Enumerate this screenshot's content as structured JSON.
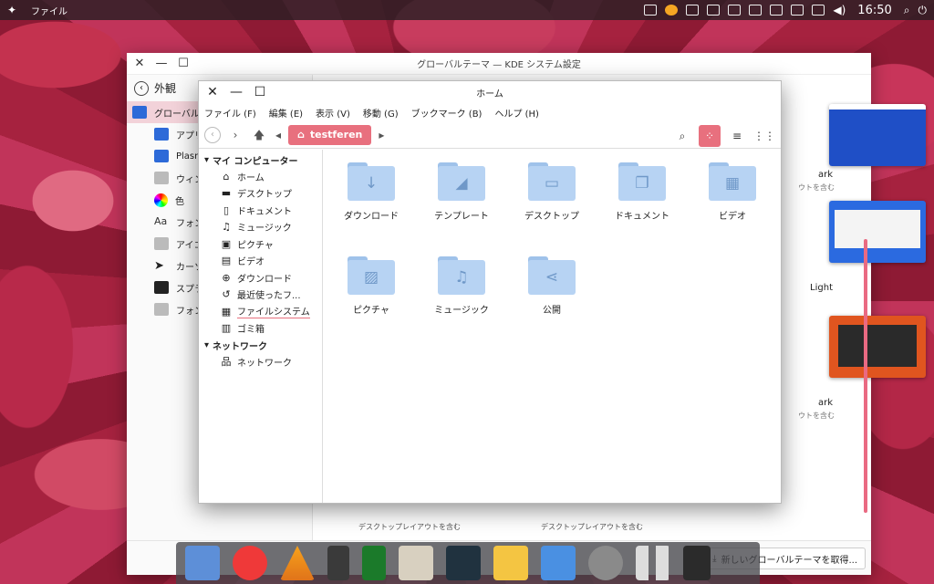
{
  "topbar": {
    "app_name": "ファイル",
    "clock": "16:50"
  },
  "settings": {
    "title": "グローバルテーマ — KDE システム設定",
    "back_label": "外観",
    "sidebar": [
      {
        "label": "グローバル",
        "top": true,
        "icon": "shirt-icon"
      },
      {
        "label": "アプリ",
        "icon": "app-style-icon"
      },
      {
        "label": "Plasma",
        "icon": "plasma-style-icon"
      },
      {
        "label": "ウィン",
        "icon": "window-decoration-icon"
      },
      {
        "label": "色",
        "icon": "color-wheel-icon"
      },
      {
        "label": "フォン",
        "icon": "font-icon"
      },
      {
        "label": "アイコ",
        "icon": "icons-icon"
      },
      {
        "label": "カーソ",
        "icon": "cursor-icon"
      },
      {
        "label": "スプラ",
        "icon": "splash-icon"
      },
      {
        "label": "フォン",
        "icon": "font-management-icon"
      }
    ],
    "themes": [
      {
        "label": "ark",
        "sub": "ウトを含む"
      },
      {
        "label": "Light",
        "sub": ""
      },
      {
        "label": "ark",
        "sub": "ウトを含む"
      }
    ],
    "layout_labels": [
      "デスクトップレイアウトを含む",
      "デスクトップレイアウトを含む"
    ],
    "get_new_label": "新しいグローバルテーマを取得..."
  },
  "dolphin": {
    "title": "ホーム",
    "menu": [
      "ファイル (F)",
      "編集 (E)",
      "表示 (V)",
      "移動 (G)",
      "ブックマーク (B)",
      "ヘルプ (H)"
    ],
    "breadcrumb": "testferen",
    "places_group": "マイ コンピューター",
    "places": [
      {
        "label": "ホーム",
        "icon": "⌂"
      },
      {
        "label": "デスクトップ",
        "icon": "▬"
      },
      {
        "label": "ドキュメント",
        "icon": "▯"
      },
      {
        "label": "ミュージック",
        "icon": "♫"
      },
      {
        "label": "ピクチャ",
        "icon": "▣"
      },
      {
        "label": "ビデオ",
        "icon": "▤"
      },
      {
        "label": "ダウンロード",
        "icon": "⊕"
      },
      {
        "label": "最近使ったフ...",
        "icon": "↺"
      },
      {
        "label": "ファイルシステム",
        "icon": "▦"
      },
      {
        "label": "ゴミ箱",
        "icon": "▥"
      }
    ],
    "network_group": "ネットワーク",
    "network": [
      {
        "label": "ネットワーク",
        "icon": "品"
      }
    ],
    "folders": [
      {
        "name": "ダウンロード",
        "glyph": "↓"
      },
      {
        "name": "テンプレート",
        "glyph": "◢"
      },
      {
        "name": "デスクトップ",
        "glyph": "▭"
      },
      {
        "name": "ドキュメント",
        "glyph": "❐"
      },
      {
        "name": "ビデオ",
        "glyph": "▦"
      },
      {
        "name": "ピクチャ",
        "glyph": "▨"
      },
      {
        "name": "ミュージック",
        "glyph": "♫"
      },
      {
        "name": "公開",
        "glyph": "⋖"
      }
    ]
  },
  "dock": {
    "items": [
      "files",
      "vivaldi",
      "vlc",
      "notes",
      "notepad",
      "photos",
      "monitor",
      "mail",
      "store",
      "settings",
      "grid",
      "trash"
    ]
  }
}
